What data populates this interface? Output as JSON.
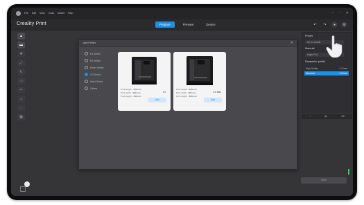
{
  "window": {
    "menu": [
      "File",
      "Edit",
      "View",
      "Tools",
      "Model",
      "Help"
    ],
    "controls": {
      "minimize": "–",
      "maximize": "▫",
      "close": "✕"
    }
  },
  "toolbar": {
    "app_title": "Creality Print",
    "tabs": [
      {
        "label": "Prepare",
        "active": true
      },
      {
        "label": "Preview",
        "active": false
      },
      {
        "label": "Device",
        "active": false
      }
    ]
  },
  "dialog": {
    "title": "Add Printer",
    "close": "✕",
    "series": [
      {
        "label": "K1 Series",
        "selected": false
      },
      {
        "label": "K2 Series",
        "selected": false
      },
      {
        "label": "Ender Series",
        "selected": false
      },
      {
        "label": "CR Series",
        "selected": true
      },
      {
        "label": "Halot Series",
        "selected": false
      },
      {
        "label": "Others",
        "selected": false
      }
    ],
    "printers": [
      {
        "name": "K1",
        "specs": [
          {
            "label": "Print length:",
            "value": "220 mm"
          },
          {
            "label": "Print width:",
            "value": "220 mm"
          },
          {
            "label": "Print height:",
            "value": "250 mm"
          }
        ],
        "add_label": "Add"
      },
      {
        "name": "K1 Max",
        "specs": [
          {
            "label": "Print length:",
            "value": "300 mm"
          },
          {
            "label": "Print width:",
            "value": "300 mm"
          },
          {
            "label": "Print height:",
            "value": "300 mm"
          }
        ],
        "add_label": "Add"
      }
    ]
  },
  "right_panel": {
    "printer_head": "Printer",
    "printer_value": "K1 0.4 nozzle",
    "material_head": "Material",
    "material_value": "Hyper PLA",
    "params_head": "Parameter profile",
    "profiles": [
      {
        "label": "High Quality",
        "value": "0.12mm",
        "selected": false
      },
      {
        "label": "Standard",
        "value": "0.20mm",
        "selected": true
      }
    ],
    "foot_icons": [
      "+",
      "▤",
      "⌫"
    ]
  },
  "slice_label": "Slice",
  "colors": {
    "accent": "#1c8fe6",
    "green": "#2fcf5a"
  }
}
